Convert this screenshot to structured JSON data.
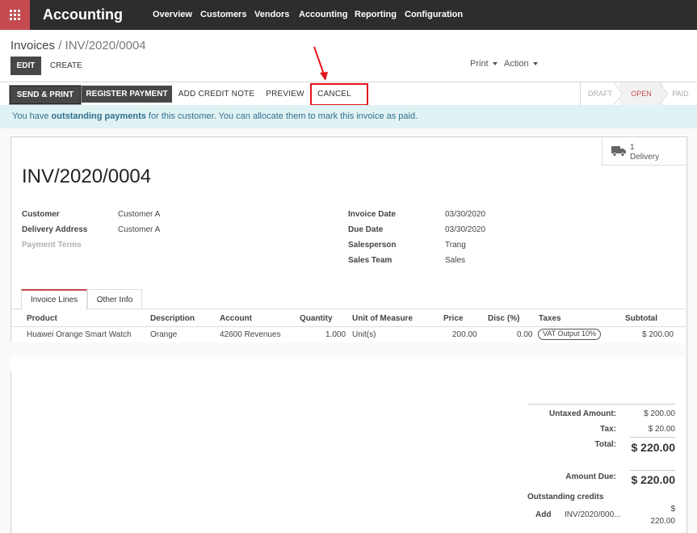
{
  "navbar": {
    "brand": "Accounting",
    "menu": [
      "Overview",
      "Customers",
      "Vendors",
      "Accounting",
      "Reporting",
      "Configuration"
    ]
  },
  "breadcrumb": {
    "parent": "Invoices",
    "separator": "/",
    "current": "INV/2020/0004"
  },
  "control": {
    "edit": "EDIT",
    "create": "CREATE",
    "print": "Print",
    "action": "Action"
  },
  "statusbar": {
    "send_print": "SEND & PRINT",
    "register_payment": "REGISTER PAYMENT",
    "add_credit_note": "ADD CREDIT NOTE",
    "preview": "PREVIEW",
    "cancel": "CANCEL",
    "stages": [
      "DRAFT",
      "OPEN",
      "PAID"
    ],
    "active_stage": "OPEN"
  },
  "alert": {
    "before": "You have ",
    "bold": "outstanding payments",
    "after": " for this customer. You can allocate them to mark this invoice as paid."
  },
  "smart_button": {
    "count": "1",
    "label": "Delivery",
    "icon": "truck-icon"
  },
  "invoice": {
    "title": "INV/2020/0004",
    "left": [
      {
        "label": "Customer",
        "value": "Customer A"
      },
      {
        "label": "Delivery Address",
        "value": "Customer A"
      },
      {
        "label": "Payment Terms",
        "value": ""
      }
    ],
    "right": [
      {
        "label": "Invoice Date",
        "value": "03/30/2020"
      },
      {
        "label": "Due Date",
        "value": "03/30/2020"
      },
      {
        "label": "Salesperson",
        "value": "Trang"
      },
      {
        "label": "Sales Team",
        "value": "Sales"
      }
    ]
  },
  "tabs": [
    "Invoice Lines",
    "Other Info"
  ],
  "lines": {
    "headers": [
      "Product",
      "Description",
      "Account",
      "Quantity",
      "Unit of Measure",
      "Price",
      "Disc (%)",
      "Taxes",
      "Subtotal"
    ],
    "rows": [
      {
        "product": "Huawei Orange Smart Watch",
        "description": "Orange",
        "account": "42600 Revenues",
        "quantity": "1.000",
        "uom": "Unit(s)",
        "price": "200.00",
        "disc": "0.00",
        "taxes": "VAT Output 10%",
        "subtotal": "$ 200.00"
      }
    ]
  },
  "totals": {
    "untaxed_label": "Untaxed Amount:",
    "untaxed": "$ 200.00",
    "tax_label": "Tax:",
    "tax": "$ 20.00",
    "total_label": "Total:",
    "total": "$ 220.00",
    "due_label": "Amount Due:",
    "due": "$ 220.00",
    "outstanding_title": "Outstanding credits",
    "credit": {
      "action": "Add",
      "ref": "INV/2020/000...",
      "currency": "$",
      "amount": "220.00"
    }
  },
  "colors": {
    "brand": "#c54a4f",
    "navbar": "#2d2d2d",
    "highlight": "#e3131b",
    "alert_bg": "#e0f2f3"
  }
}
